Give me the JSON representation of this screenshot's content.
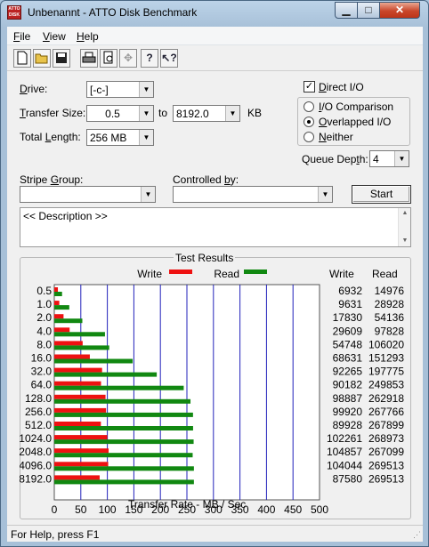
{
  "window": {
    "title": "Unbenannt - ATTO Disk Benchmark",
    "icon_text": "ATTO DISK BMRK"
  },
  "menu": [
    {
      "accel": "F",
      "rest": "ile"
    },
    {
      "accel": "V",
      "rest": "iew"
    },
    {
      "accel": "H",
      "rest": "elp"
    }
  ],
  "toolbar": {
    "buttons": [
      "new-file-icon",
      "open-folder-icon",
      "save-icon",
      "print-icon",
      "print-preview-icon",
      "move-icon",
      "help-icon",
      "context-help-icon"
    ]
  },
  "form": {
    "drive_label_accel": "D",
    "drive_label_rest": "rive:",
    "drive_value": "[-c-]",
    "transfer_label_accel": "T",
    "transfer_label_rest": "ransfer Size:",
    "transfer_from": "0.5",
    "to_label": "to",
    "transfer_to": "8192.0",
    "kb_label": "KB",
    "total_label_pre": "Total ",
    "total_label_accel": "L",
    "total_label_rest": "ength:",
    "total_value": "256 MB",
    "direct_io_label_accel": "D",
    "direct_io_label_rest": "irect I/O",
    "direct_io_checked": "✓",
    "mode_options": [
      {
        "accel": "I",
        "rest": "/O Comparison",
        "selected": false
      },
      {
        "accel": "O",
        "rest": "verlapped I/O",
        "selected": true
      },
      {
        "accel": "N",
        "rest": "either",
        "selected": false
      }
    ],
    "queue_label_pre": "Queue Dep",
    "queue_label_accel": "t",
    "queue_label_rest": "h:",
    "queue_value": "4",
    "stripe_label_pre": "Stripe ",
    "stripe_label_accel": "G",
    "stripe_label_rest": "roup:",
    "stripe_value": "",
    "controlled_label_pre": "Controlled ",
    "controlled_label_accel": "b",
    "controlled_label_rest": "y:",
    "controlled_value": "",
    "start_label": "Start",
    "description": "<< Description >>"
  },
  "results": {
    "title": "Test Results",
    "write_legend": "Write",
    "read_legend": "Read",
    "col_write": "Write",
    "col_read": "Read"
  },
  "chart_data": {
    "type": "bar",
    "orientation": "horizontal",
    "title": "Test Results",
    "xlabel": "Transfer Rate - MB / Sec",
    "xlim": [
      0,
      500
    ],
    "xticks": [
      0,
      50,
      100,
      150,
      200,
      250,
      300,
      350,
      400,
      450,
      500
    ],
    "categories": [
      "0.5",
      "1.0",
      "2.0",
      "4.0",
      "8.0",
      "16.0",
      "32.0",
      "64.0",
      "128.0",
      "256.0",
      "512.0",
      "1024.0",
      "2048.0",
      "4096.0",
      "8192.0"
    ],
    "series": [
      {
        "name": "Write",
        "color": "#ee1111",
        "values": [
          6932,
          9631,
          17830,
          29609,
          54748,
          68631,
          92265,
          90182,
          98887,
          99920,
          89928,
          102261,
          104857,
          104044,
          87580
        ]
      },
      {
        "name": "Read",
        "color": "#118811",
        "values": [
          14976,
          28928,
          54136,
          97828,
          106020,
          151293,
          197775,
          249853,
          262918,
          267766,
          267899,
          268973,
          267099,
          269513,
          269513
        ]
      }
    ],
    "grid": true
  },
  "statusbar": {
    "text": "For Help, press F1"
  }
}
